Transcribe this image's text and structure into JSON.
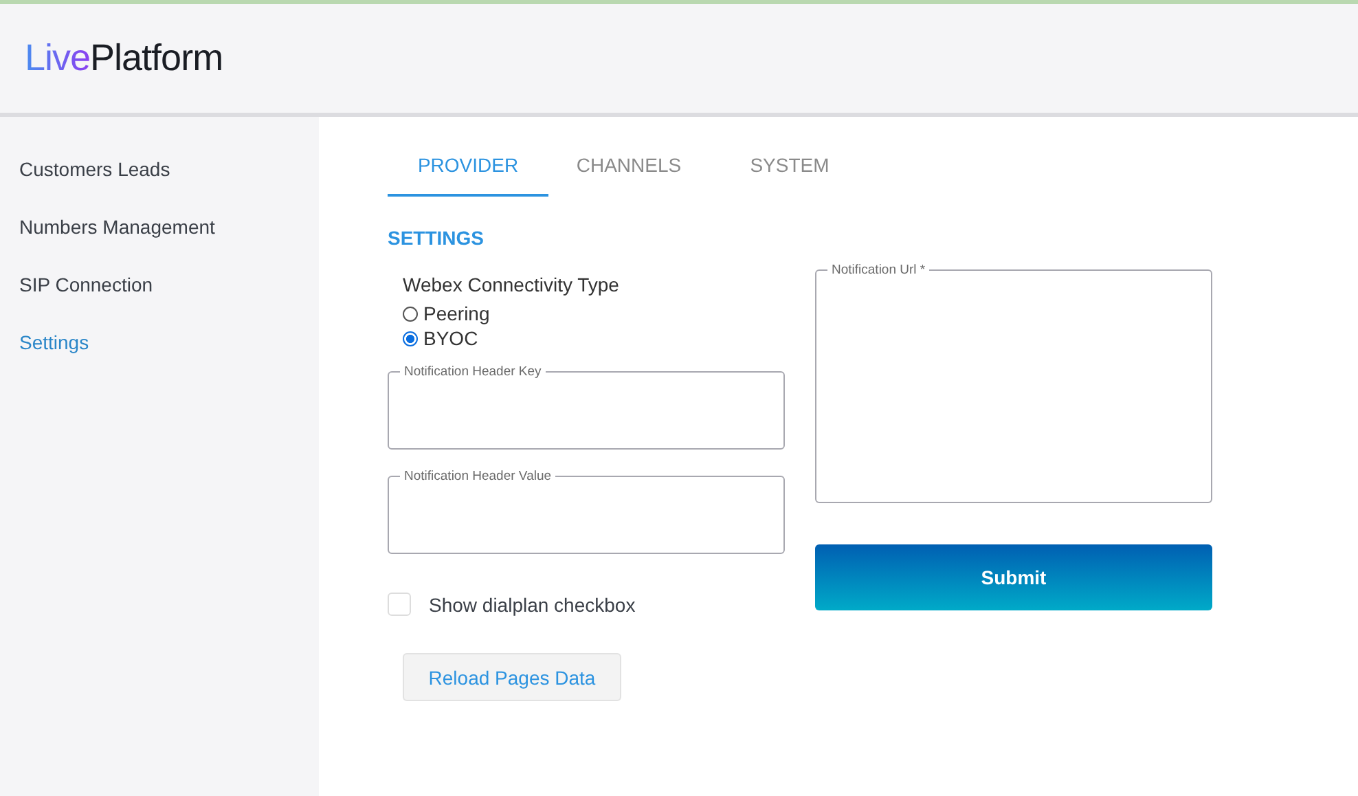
{
  "logo": {
    "prefix": "Live",
    "name": "Platform"
  },
  "sidebar": {
    "items": [
      {
        "label": "Customers Leads",
        "selected": false
      },
      {
        "label": "Numbers Management",
        "selected": false
      },
      {
        "label": "SIP Connection",
        "selected": false
      },
      {
        "label": "Settings",
        "selected": true
      }
    ]
  },
  "tabs": [
    {
      "label": "PROVIDER",
      "selected": true
    },
    {
      "label": "CHANNELS",
      "selected": false
    },
    {
      "label": "SYSTEM",
      "selected": false
    }
  ],
  "section_title": "SETTINGS",
  "connectivity": {
    "label": "Webex Connectivity Type",
    "options": [
      {
        "label": "Peering",
        "selected": false
      },
      {
        "label": "BYOC",
        "selected": true
      }
    ]
  },
  "fields": [
    {
      "label": "Notification Header Key"
    },
    {
      "label": "Notification Header Value"
    }
  ],
  "dialplan": {
    "label": "Show dialplan checkbox",
    "checked": false
  },
  "reload_button": "Reload Pages Data",
  "url_field": {
    "label": "Notification Url *"
  },
  "submit_button": "Submit"
}
